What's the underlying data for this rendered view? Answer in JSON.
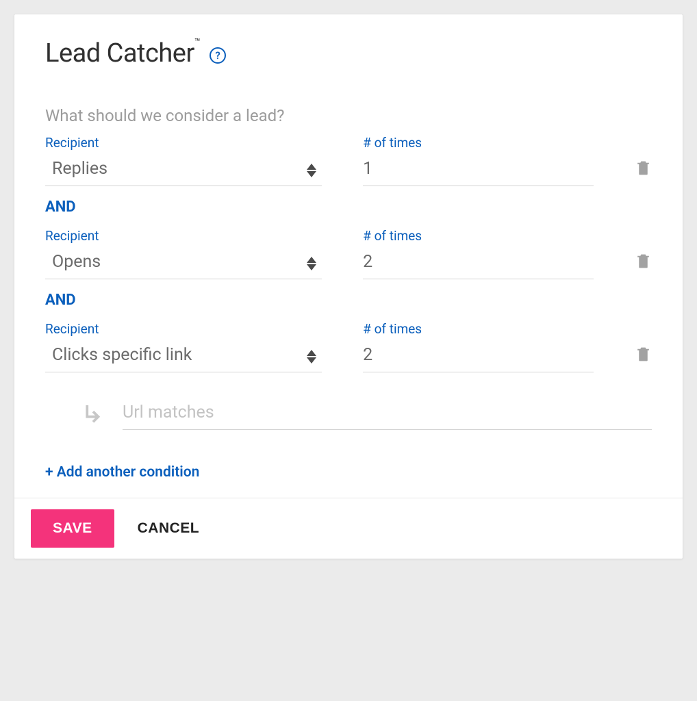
{
  "header": {
    "title": "Lead Catcher",
    "trademark": "™",
    "help_icon_label": "?"
  },
  "subtitle": "What should we consider a lead?",
  "labels": {
    "recipient": "Recipient",
    "times": "# of times"
  },
  "conditions": [
    {
      "type": "Replies",
      "count": "1"
    },
    {
      "type": "Opens",
      "count": "2"
    },
    {
      "type": "Clicks specific link",
      "count": "2"
    }
  ],
  "operator": "AND",
  "subcondition": {
    "url_placeholder": "Url matches",
    "url_value": ""
  },
  "add_link": "+ Add another condition",
  "footer": {
    "save": "SAVE",
    "cancel": "CANCEL"
  }
}
